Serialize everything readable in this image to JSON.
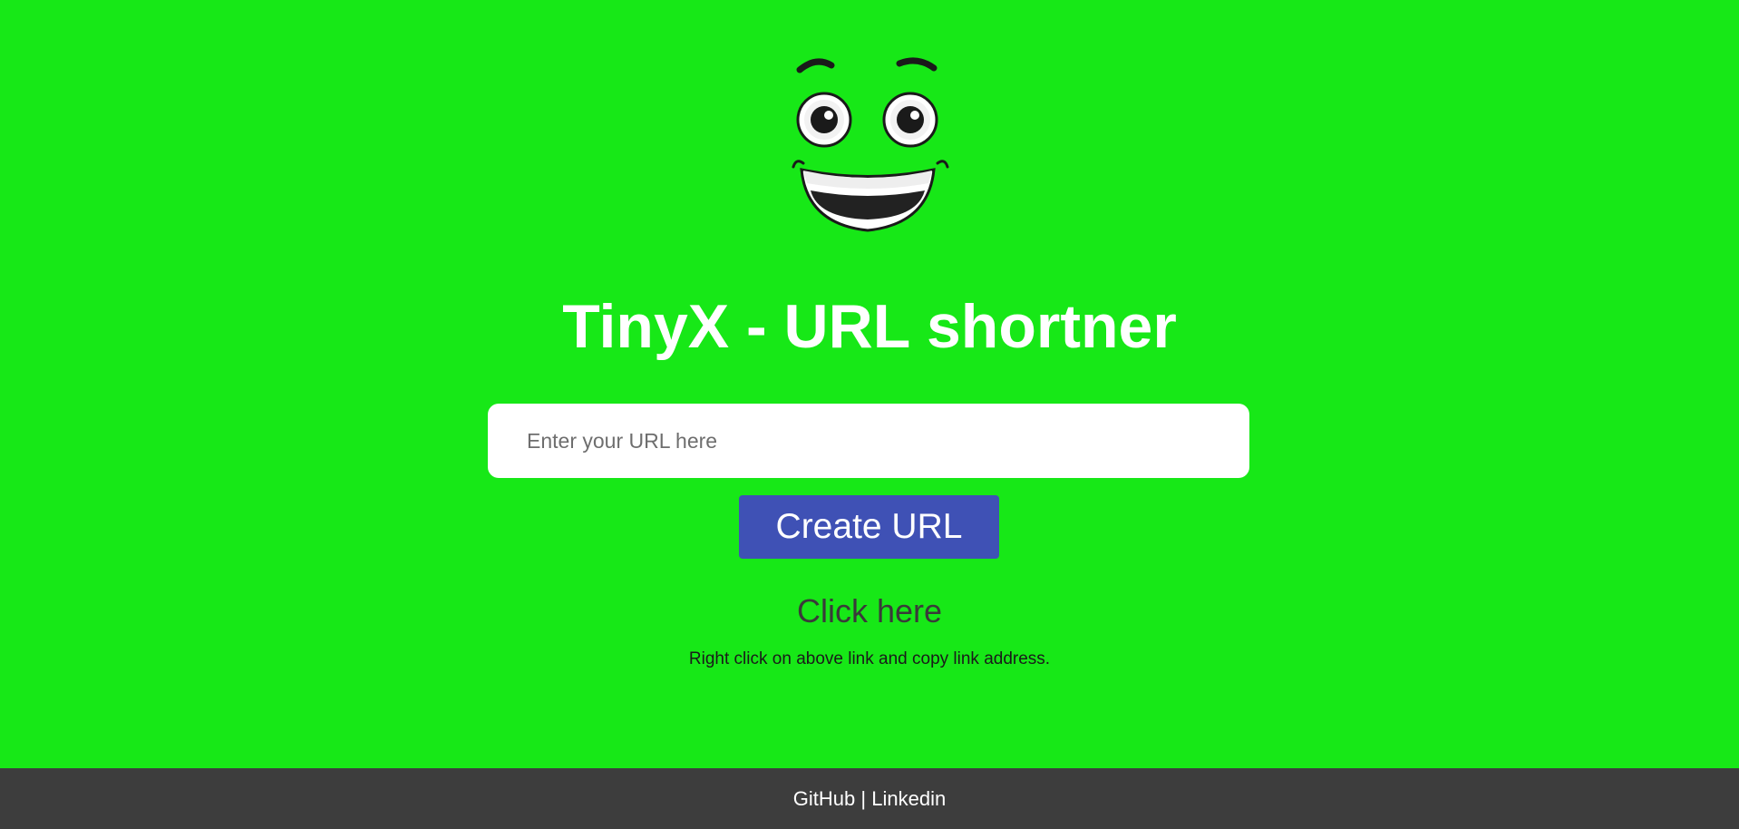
{
  "header": {
    "logo_icon": "smiley-face-icon",
    "title": "TinyX - URL shortner"
  },
  "form": {
    "url_placeholder": "Enter your URL here",
    "url_value": "",
    "create_label": "Create URL"
  },
  "result": {
    "link_label": "Click here",
    "hint": "Right click on above link and copy link address."
  },
  "footer": {
    "github_label": "GitHub",
    "separator": " | ",
    "linkedin_label": "Linkedin"
  },
  "colors": {
    "background": "#17e817",
    "button": "#3f51b5",
    "footer": "#3d3d3d",
    "title": "#ffffff"
  }
}
